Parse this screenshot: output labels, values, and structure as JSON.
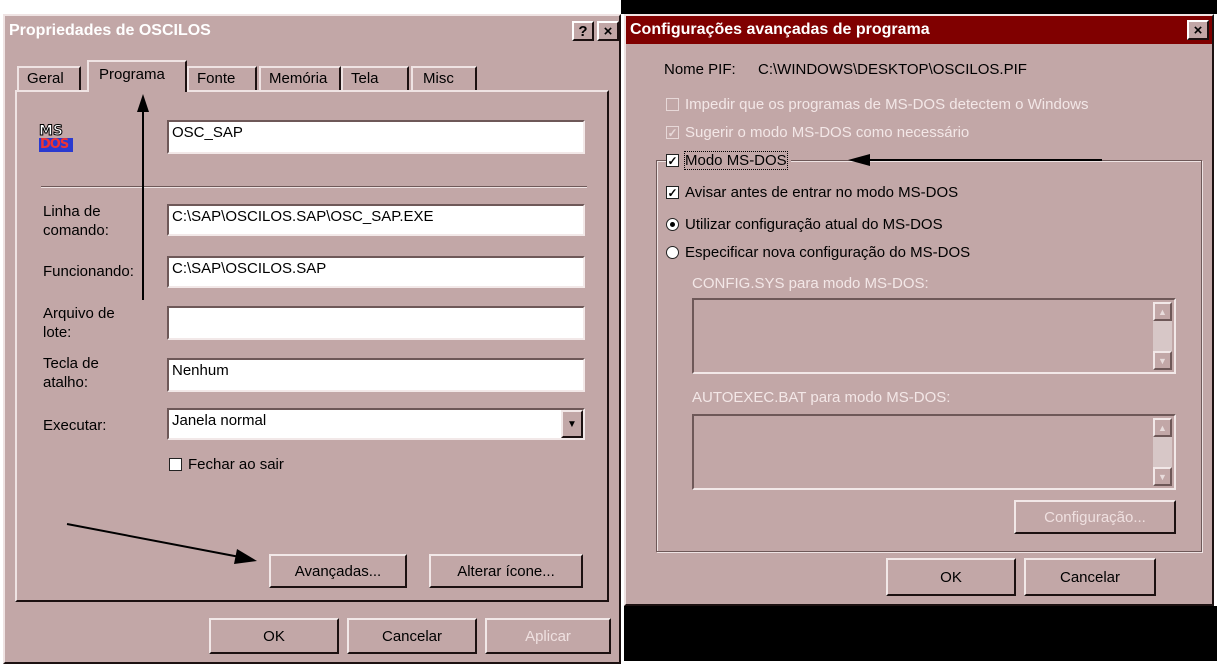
{
  "left_dialog": {
    "title": "Propriedades de OSCILOS",
    "help_btn": "?",
    "close_btn": "×",
    "tabs": [
      "Geral",
      "Programa",
      "Fonte",
      "Memória",
      "Tela",
      "Misc"
    ],
    "icon_text_top": "MS",
    "icon_text_bottom": "DOS",
    "program_name": "OSC_SAP",
    "command_line_label": "Linha de comando:",
    "command_line_value": "C:\\SAP\\OSCILOS.SAP\\OSC_SAP.EXE",
    "working_dir_label": "Funcionando:",
    "working_dir_value": "C:\\SAP\\OSCILOS.SAP",
    "batch_file_label": "Arquivo de lote:",
    "batch_file_value": "",
    "shortcut_label": "Tecla de atalho:",
    "shortcut_value": "Nenhum",
    "run_label": "Executar:",
    "run_value": "Janela normal",
    "close_on_exit_label": "Fechar ao sair",
    "advanced_button": "Avançadas...",
    "change_icon_button": "Alterar ícone...",
    "ok_button": "OK",
    "cancel_button": "Cancelar",
    "apply_button": "Aplicar"
  },
  "right_dialog": {
    "title": "Configurações avançadas de programa",
    "close_btn": "×",
    "pif_name_label": "Nome PIF:",
    "pif_name_value": "C:\\WINDOWS\\DESKTOP\\OSCILOS.PIF",
    "prevent_detect_label": "Impedir que os programas de MS-DOS detectem o Windows",
    "suggest_mode_label": "Sugerir o modo MS-DOS como necessário",
    "msdos_mode_label": "Modo MS-DOS",
    "warn_before_label": "Avisar antes de entrar no modo MS-DOS",
    "use_current_label": "Utilizar configuração atual do MS-DOS",
    "specify_new_label": "Especificar nova configuração do MS-DOS",
    "config_sys_label": "CONFIG.SYS para modo MS-DOS:",
    "autoexec_label": "AUTOEXEC.BAT para modo MS-DOS:",
    "configuration_button": "Configuração...",
    "ok_button": "OK",
    "cancel_button": "Cancelar"
  },
  "colors": {
    "left_title_bg": "#c2a7a7",
    "right_title_bg": "#800000",
    "dialog_face": "#c2a7a7"
  }
}
